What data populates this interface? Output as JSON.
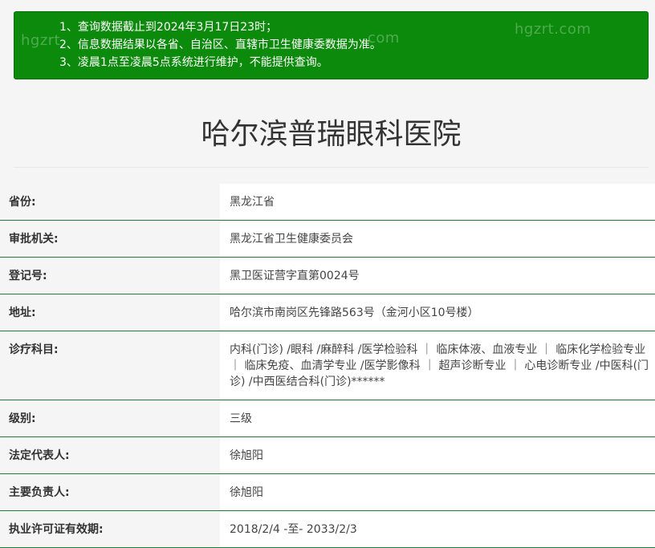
{
  "notice": {
    "lines": [
      "1、查询数据截止到2024年3月17日23时；",
      "2、信息数据结果以各省、自治区、直辖市卫生健康委数据为准。",
      "3、凌晨1点至凌晨5点系统进行维护，不能提供查询。"
    ],
    "watermarks": [
      "hgzrt",
      "com",
      "hgzrt.com"
    ],
    "background_color": "#0b8a0b"
  },
  "title": "哈尔滨普瑞眼科医院",
  "rows": [
    {
      "label": "省份:",
      "value": "黑龙江省"
    },
    {
      "label": "审批机关:",
      "value": "黑龙江省卫生健康委员会"
    },
    {
      "label": "登记号:",
      "value": "黑卫医证营字直第0024号"
    },
    {
      "label": "地址:",
      "value": "哈尔滨市南岗区先锋路563号（金河小区10号楼）"
    },
    {
      "label": "诊疗科目:",
      "value": "内科(门诊) /眼科 /麻醉科 /医学检验科 ｜ 临床体液、血液专业 ｜ 临床化学检验专业 ｜ 临床免疫、血清学专业 /医学影像科 ｜ 超声诊断专业 ｜ 心电诊断专业 /中医科(门诊) /中西医结合科(门诊)******"
    },
    {
      "label": "级别:",
      "value": "三级"
    },
    {
      "label": "法定代表人:",
      "value": "徐旭阳"
    },
    {
      "label": "主要负责人:",
      "value": "徐旭阳"
    },
    {
      "label": "执业许可证有效期:",
      "value": "2018/2/4 -至- 2033/2/3"
    }
  ],
  "colors": {
    "row_border": "#1f7a3a",
    "label_bg": "#f5f5f5",
    "value_bg": "#ffffff"
  }
}
